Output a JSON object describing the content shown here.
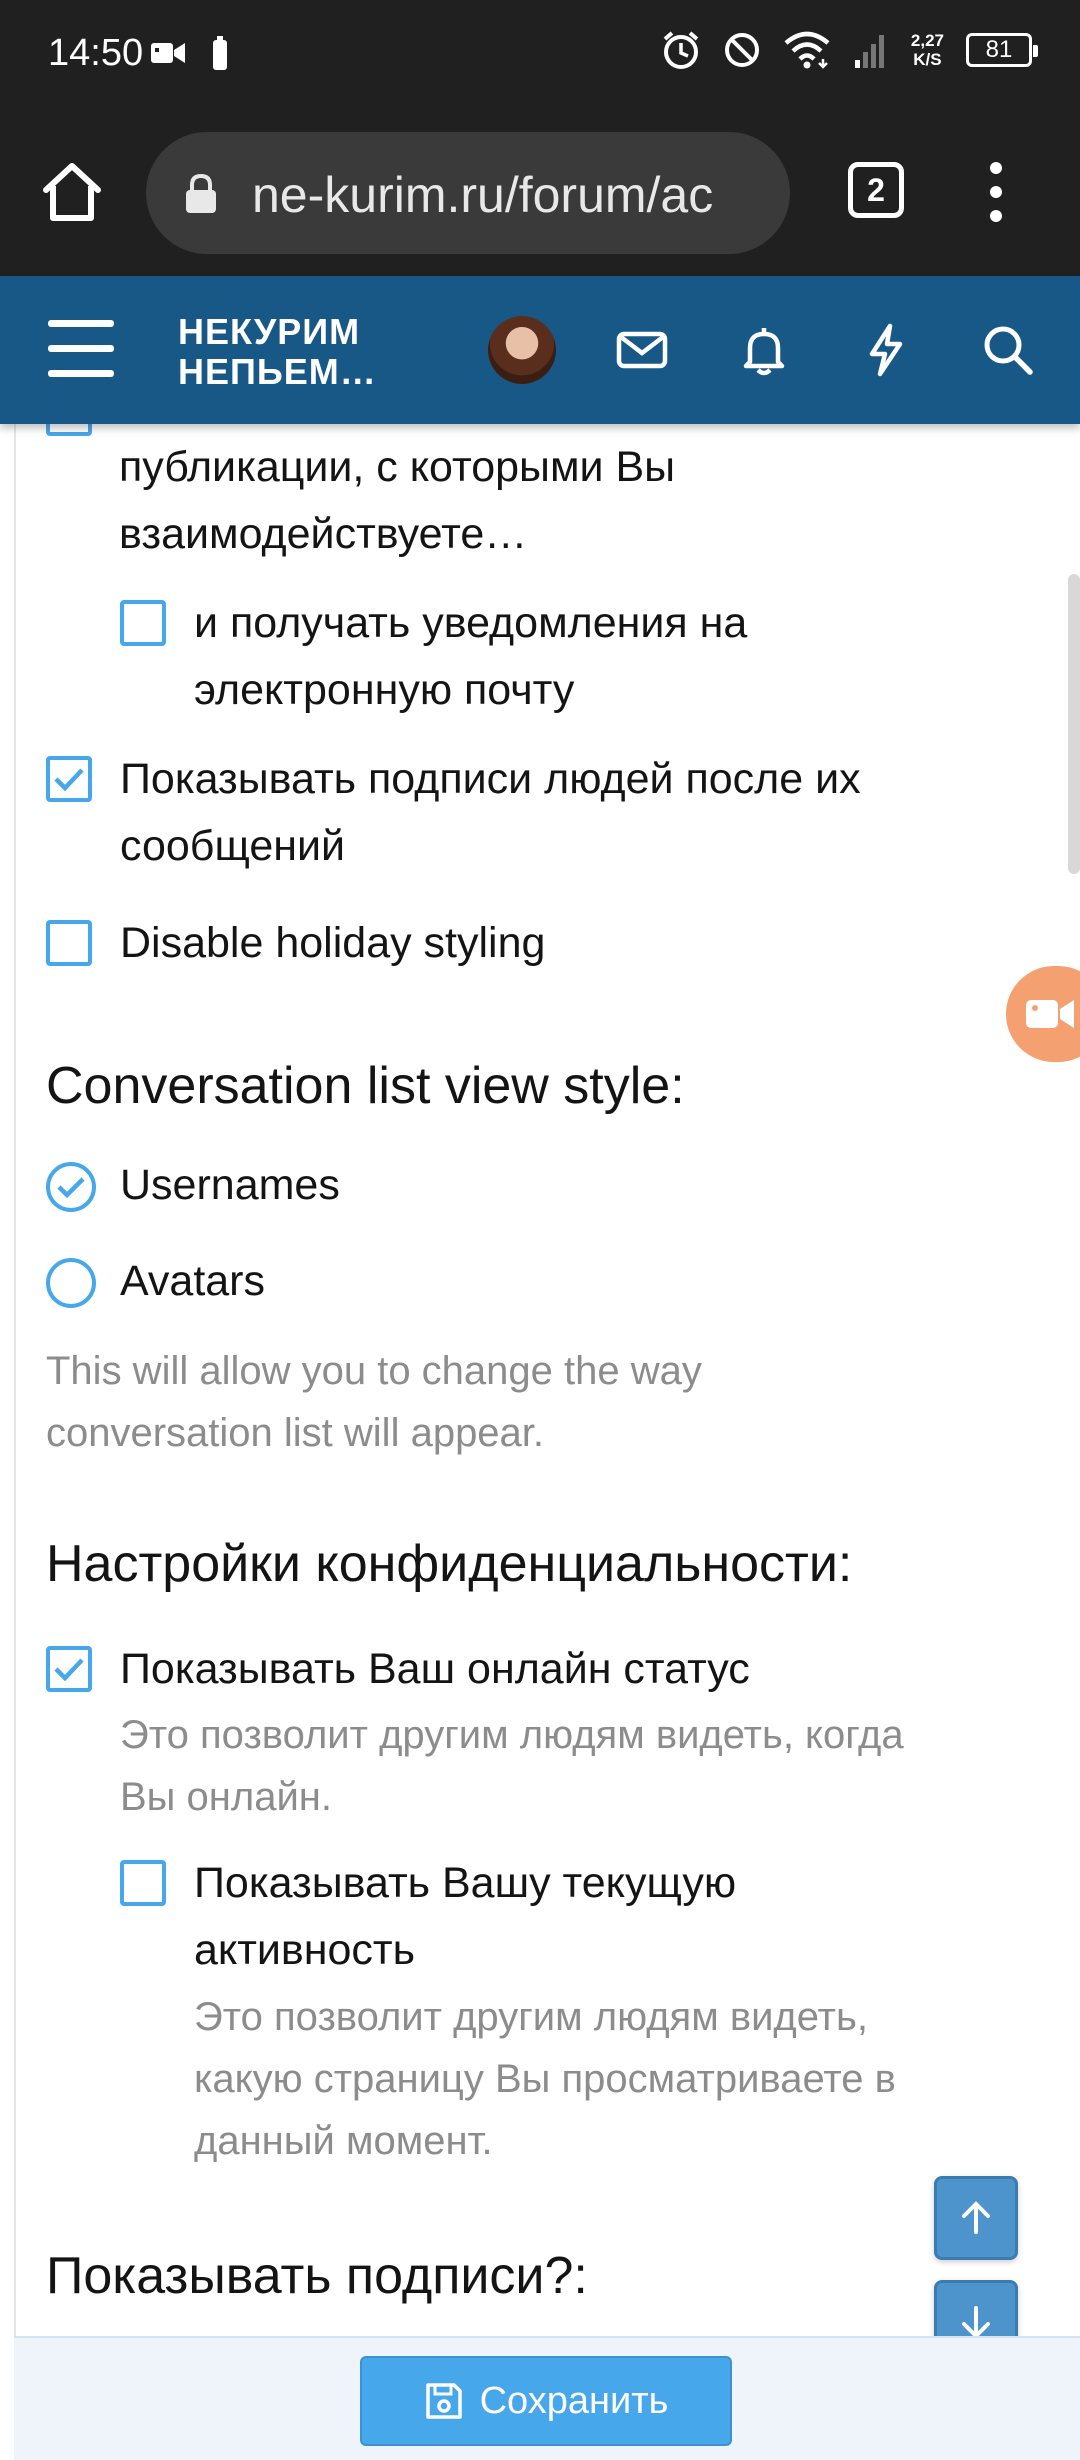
{
  "status_bar": {
    "time": "14:50",
    "net_speed_value": "2,27",
    "net_speed_unit": "K/S",
    "battery": "81"
  },
  "browser": {
    "url": "ne-kurim.ru/forum/ac",
    "tab_count": "2"
  },
  "forum_header": {
    "logo_line1": "НЕКУРИМ",
    "logo_line2": "НЕПЬЕМ…"
  },
  "content": {
    "partial_option_line1": "публикации, с которыми Вы",
    "partial_option_line2": "взаимодействуете…",
    "email_option": {
      "label_line1": "и получать уведомления на",
      "label_line2": "электронную почту",
      "checked": false
    },
    "signatures_option": {
      "label_line1": "Показывать подписи людей после их",
      "label_line2": "сообщений",
      "checked": true
    },
    "holiday_option": {
      "label": "Disable holiday styling",
      "checked": false
    },
    "conversation_section": {
      "title": "Conversation list view style:",
      "options": [
        {
          "label": "Usernames",
          "selected": true
        },
        {
          "label": "Avatars",
          "selected": false
        }
      ],
      "hint_line1": "This will allow you to change the way",
      "hint_line2": "conversation list will appear."
    },
    "privacy_section": {
      "title": "Настройки конфиденциальности:",
      "online_status": {
        "label": "Показывать Ваш онлайн статус",
        "checked": true,
        "hint_line1": "Это позволит другим людям видеть, когда",
        "hint_line2": "Вы онлайн."
      },
      "activity": {
        "label_line1": "Показывать Вашу текущую",
        "label_line2": "активность",
        "checked": false,
        "hint_line1": "Это позволит другим людям видеть,",
        "hint_line2": "какую страницу Вы просматриваете в",
        "hint_line3": "данный момент."
      }
    },
    "signatures_section_title": "Показывать подписи?:"
  },
  "footer": {
    "save_label": "Сохранить"
  },
  "colors": {
    "header_bg": "#185886",
    "accent": "#47a7eb",
    "browser_bg": "#202020"
  }
}
